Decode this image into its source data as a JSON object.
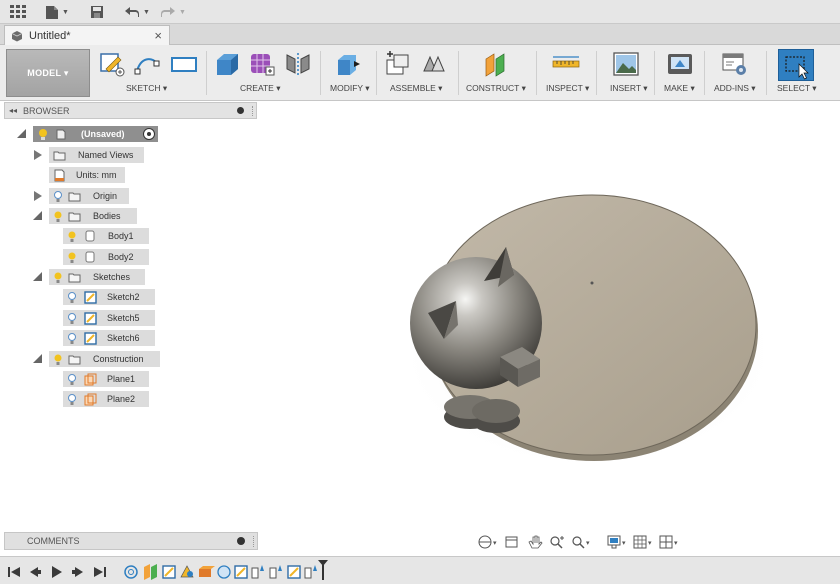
{
  "document": {
    "tab_title": "Untitled*",
    "close_glyph": "×"
  },
  "toolbar": {
    "workspace": "MODEL ▾",
    "groups": [
      {
        "id": "sketch",
        "label": "SKETCH ▾"
      },
      {
        "id": "create",
        "label": "CREATE ▾"
      },
      {
        "id": "modify",
        "label": "MODIFY ▾"
      },
      {
        "id": "assemble",
        "label": "ASSEMBLE ▾"
      },
      {
        "id": "construct",
        "label": "CONSTRUCT ▾"
      },
      {
        "id": "inspect",
        "label": "INSPECT ▾"
      },
      {
        "id": "insert",
        "label": "INSERT ▾"
      },
      {
        "id": "make",
        "label": "MAKE ▾"
      },
      {
        "id": "addins",
        "label": "ADD-INS ▾"
      },
      {
        "id": "select",
        "label": "SELECT ▾"
      }
    ]
  },
  "browser": {
    "header": "BROWSER",
    "collapse_glyph": "◂◂",
    "tree": {
      "root": "(Unsaved)",
      "named_views": "Named Views",
      "units": "Units: mm",
      "origin": "Origin",
      "bodies": "Bodies",
      "body1": "Body1",
      "body2": "Body2",
      "sketches": "Sketches",
      "sketch2": "Sketch2",
      "sketch5": "Sketch5",
      "sketch6": "Sketch6",
      "construction": "Construction",
      "plane1": "Plane1",
      "plane2": "Plane2"
    }
  },
  "comments": {
    "label": "COMMENTS"
  },
  "colors": {
    "accent_blue": "#2f7fc1",
    "selected_node": "#8f8f8f",
    "disc": "#b3a999",
    "sphere": "#8a8780",
    "bulb": "#f2c31f",
    "plane_orange": "#e07a2a"
  }
}
